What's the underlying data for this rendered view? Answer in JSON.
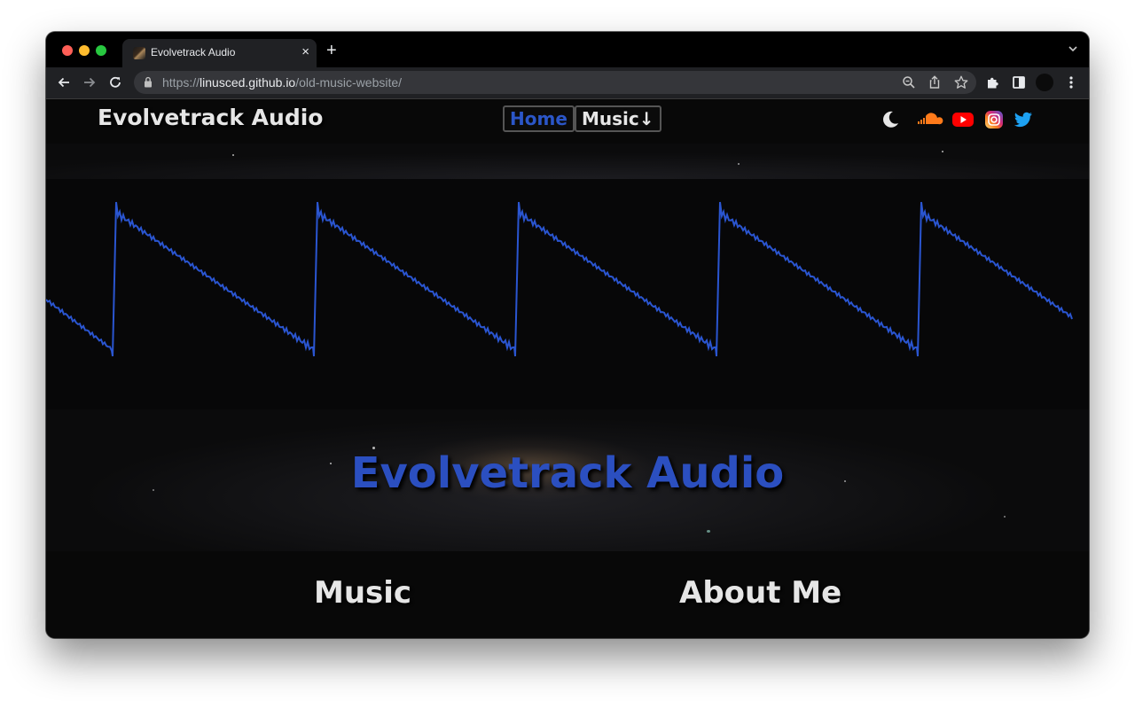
{
  "browser": {
    "tab_title": "Evolvetrack Audio",
    "tab_close": "×",
    "new_tab": "+",
    "url_scheme": "https://",
    "url_host": "linusced.github.io",
    "url_path": "/old-music-website/"
  },
  "site": {
    "name": "Evolvetrack Audio",
    "nav": {
      "home_label": "Home",
      "music_label": "Music",
      "music_arrow": "↓"
    },
    "social_icons": [
      "moon-icon",
      "soundcloud-icon",
      "youtube-icon",
      "instagram-icon",
      "twitter-icon"
    ],
    "hero_title": "Evolvetrack Audio",
    "sections": {
      "music_heading": "Music",
      "about_heading": "About Me"
    },
    "colors": {
      "accent": "#2b4fc0",
      "wave": "#2a55d0",
      "text": "#e6e6e6",
      "background": "#080808"
    }
  }
}
